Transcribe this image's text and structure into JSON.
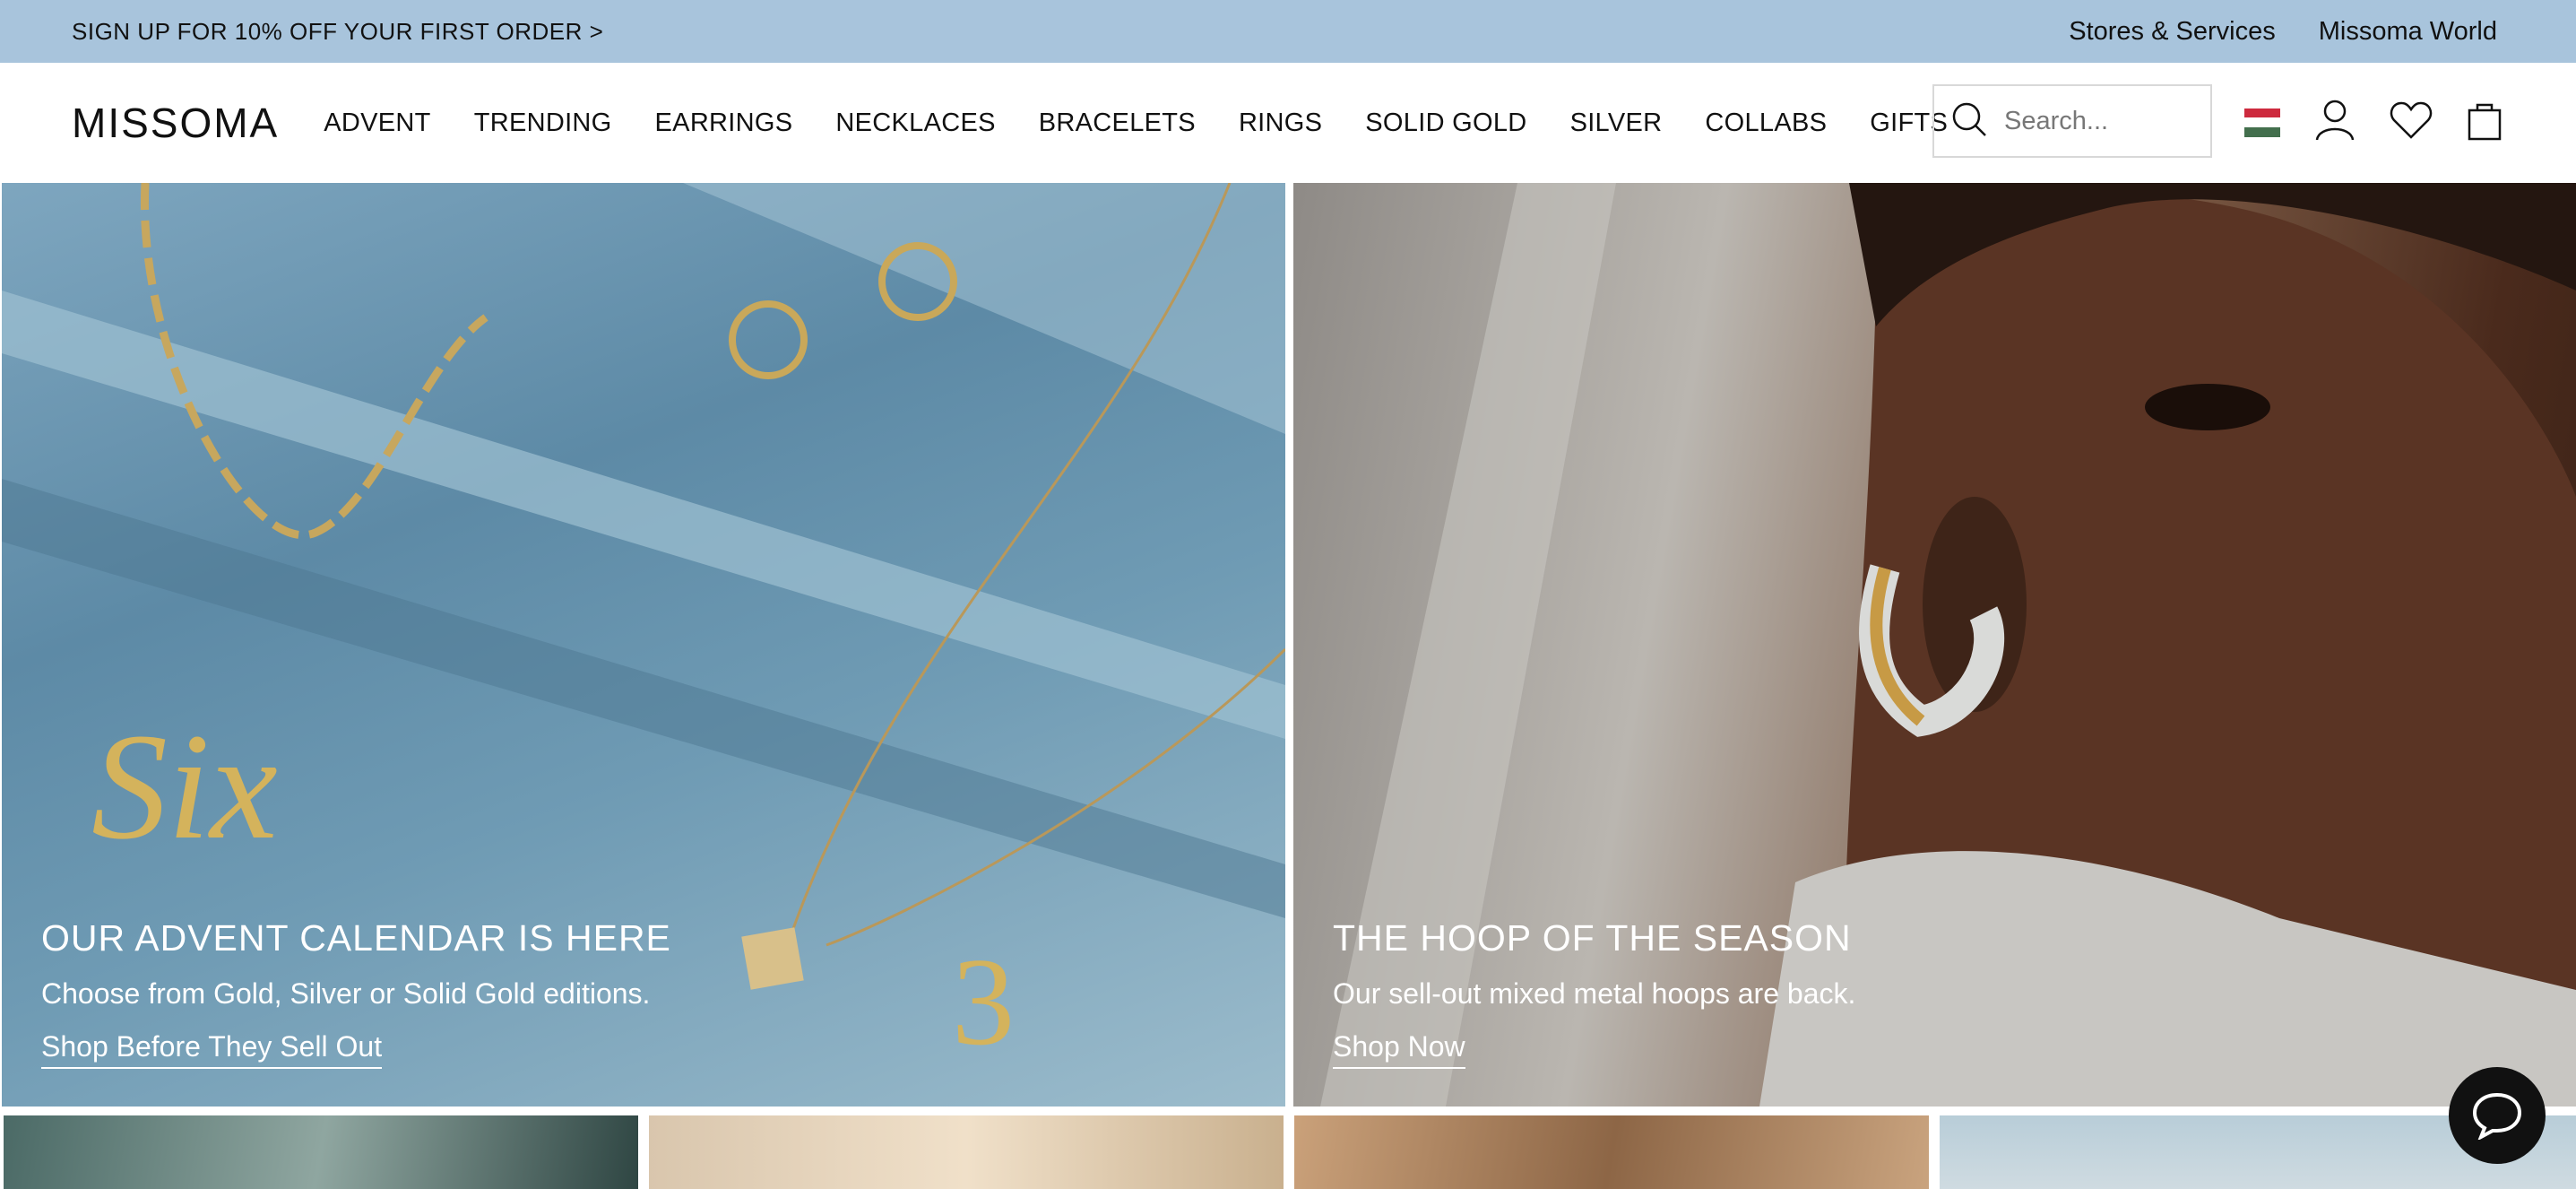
{
  "announcement": {
    "promo": "SIGN UP FOR 10% OFF YOUR FIRST ORDER >",
    "links": [
      "Stores & Services",
      "Missoma World"
    ]
  },
  "header": {
    "logo": "MISSOMA",
    "nav": [
      "ADVENT",
      "TRENDING",
      "EARRINGS",
      "NECKLACES",
      "BRACELETS",
      "RINGS",
      "SOLID GOLD",
      "SILVER",
      "COLLABS",
      "GIFTS"
    ],
    "search_placeholder": "Search...",
    "icons": [
      "search-icon",
      "flag-icon",
      "account-icon",
      "wishlist-icon",
      "bag-icon"
    ]
  },
  "hero": {
    "left": {
      "title": "OUR ADVENT CALENDAR IS HERE",
      "subtitle": "Choose from Gold, Silver or Solid Gold editions.",
      "cta": "Shop Before They Sell Out"
    },
    "right": {
      "title": "THE HOOP OF THE SEASON",
      "subtitle": "Our sell-out mixed metal hoops are back.",
      "cta": "Shop Now"
    }
  },
  "colors": {
    "announcement_bg": "#a8c4dc",
    "text": "#111111"
  }
}
